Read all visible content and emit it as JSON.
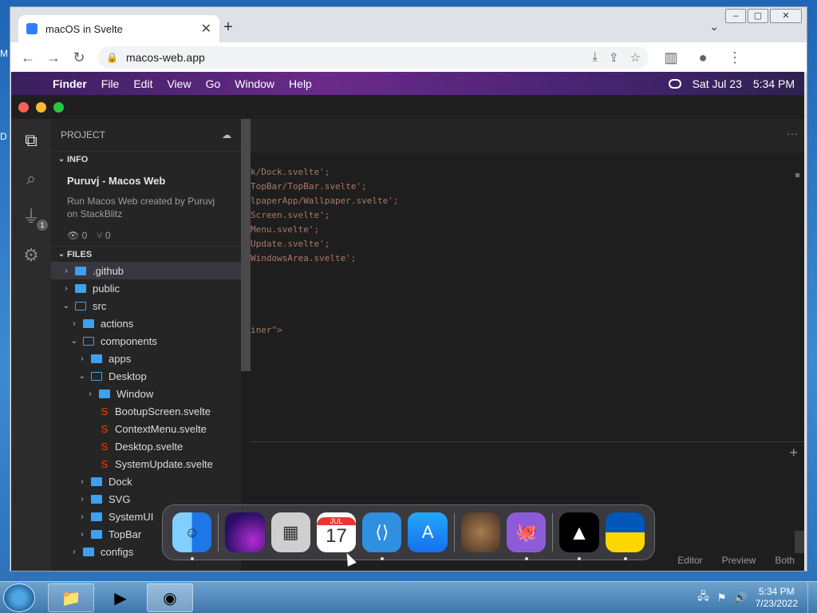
{
  "desktop": {
    "left_letter_top": "M",
    "left_letter_mid": "D"
  },
  "browser": {
    "tab_title": "macOS in Svelte",
    "tab_close": "✕",
    "new_tab": "+",
    "tab_dropdown": "⌄",
    "url": "macos-web.app",
    "window_controls": [
      "–",
      "▢",
      "✕"
    ]
  },
  "mac_menubar": {
    "apple": "",
    "items": [
      "Finder",
      "File",
      "Edit",
      "View",
      "Go",
      "Window",
      "Help"
    ],
    "date": "Sat Jul 23",
    "time": "5:34 PM"
  },
  "vscode": {
    "traffic_colors": [
      "#ff5f57",
      "#febc2e",
      "#28c840"
    ],
    "activity_badge": "1",
    "sidebar_title": "PROJECT",
    "info_section": "INFO",
    "info_title": "Puruvj - Macos Web",
    "info_desc": "Run Macos Web created by Puruvj on StackBlitz",
    "info_views": "0",
    "info_forks": "0",
    "files_section": "FILES",
    "tree": [
      {
        "label": ".github",
        "indent": 0,
        "type": "folder",
        "open": false,
        "selected": true
      },
      {
        "label": "public",
        "indent": 0,
        "type": "folder",
        "open": false
      },
      {
        "label": "src",
        "indent": 0,
        "type": "folder",
        "open": true
      },
      {
        "label": "actions",
        "indent": 1,
        "type": "folder",
        "open": false
      },
      {
        "label": "components",
        "indent": 1,
        "type": "folder",
        "open": true
      },
      {
        "label": "apps",
        "indent": 2,
        "type": "folder",
        "open": false
      },
      {
        "label": "Desktop",
        "indent": 2,
        "type": "folder",
        "open": true
      },
      {
        "label": "Window",
        "indent": 3,
        "type": "folder",
        "open": false
      },
      {
        "label": "BootupScreen.svelte",
        "indent": 3,
        "type": "svelte"
      },
      {
        "label": "ContextMenu.svelte",
        "indent": 3,
        "type": "svelte"
      },
      {
        "label": "Desktop.svelte",
        "indent": 3,
        "type": "svelte"
      },
      {
        "label": "SystemUpdate.svelte",
        "indent": 3,
        "type": "svelte"
      },
      {
        "label": "Dock",
        "indent": 2,
        "type": "folder",
        "open": false
      },
      {
        "label": "SVG",
        "indent": 2,
        "type": "folder",
        "open": false
      },
      {
        "label": "SystemUI",
        "indent": 2,
        "type": "folder",
        "open": false
      },
      {
        "label": "TopBar",
        "indent": 2,
        "type": "folder",
        "open": false
      },
      {
        "label": "configs",
        "indent": 1,
        "type": "folder",
        "open": false
      }
    ],
    "code_lines": [
      "k/Dock.svelte';",
      "TopBar/TopBar.svelte';",
      "lpaperApp/Wallpaper.svelte';",
      "Screen.svelte';",
      "Menu.svelte';",
      "Update.svelte';",
      "WindowsArea.svelte';",
      "",
      "",
      "",
      "",
      "iner\">"
    ],
    "more": "···",
    "panel_plus": "+",
    "preview_tabs": [
      "Editor",
      "Preview",
      "Both"
    ]
  },
  "dock": {
    "calendar_month": "JUL",
    "calendar_day": "17",
    "items": [
      {
        "name": "finder",
        "bg": "#2b8cf2",
        "dot": true
      },
      {
        "name": "wallpapers",
        "bg": "#3a1a7a",
        "dot": false
      },
      {
        "name": "calculator",
        "bg": "#d0d0d0",
        "dot": false
      },
      {
        "name": "calendar",
        "bg": "#ffffff",
        "dot": false
      },
      {
        "name": "vscode",
        "bg": "#2f8fe0",
        "dot": true
      },
      {
        "name": "appstore",
        "bg": "#1d8cf4",
        "dot": false
      },
      {
        "name": "purus-twitter",
        "bg": "#6b4b2f",
        "dot": false
      },
      {
        "name": "github",
        "bg": "#8e5bd8",
        "dot": true
      },
      {
        "name": "vercel",
        "bg": "#000000",
        "dot": true
      },
      {
        "name": "ukraine",
        "bg": "#0057b7",
        "dot": true
      }
    ]
  },
  "taskbar": {
    "time": "5:34 PM",
    "date": "7/23/2022"
  }
}
